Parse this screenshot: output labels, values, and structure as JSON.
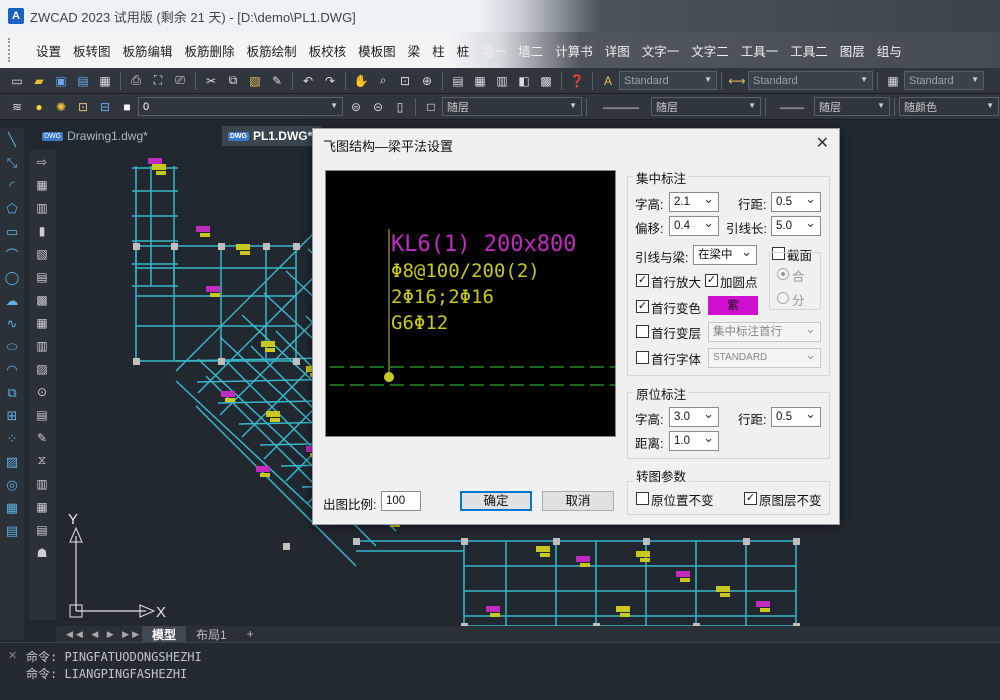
{
  "window": {
    "title": "ZWCAD 2023 试用版 (剩余 21 天) - [D:\\demo\\PL1.DWG]",
    "logo": "A"
  },
  "menu": [
    "设置",
    "板转图",
    "板筋编辑",
    "板筋删除",
    "板筋绘制",
    "板校核",
    "模板图",
    "梁",
    "柱",
    "桩",
    "墙一",
    "墙二",
    "计算书",
    "详图",
    "文字一",
    "文字二",
    "工具一",
    "工具二",
    "图层",
    "组与"
  ],
  "toolbar1": {
    "text_style": "Standard",
    "dim_style": "Standard",
    "table_style": "Standard"
  },
  "toolbar2": {
    "layer_name": "0",
    "color": "随层",
    "linetype": "随层",
    "lineweight": "随层",
    "plotstyle": "随颜色"
  },
  "doc_tabs": [
    {
      "label": "Drawing1.dwg*",
      "badge": "DWG"
    },
    {
      "label": "PL1.DWG*",
      "badge": "DWG"
    }
  ],
  "model_tabs": {
    "model": "模型",
    "layout": "布局1",
    "add": "+"
  },
  "ucs": {
    "x": "X",
    "y": "Y"
  },
  "command_lines": [
    "命令: PINGFATUODONGSHEZHI",
    "命令: LIANGPINGFASHEZHI"
  ],
  "dialog": {
    "title": "飞图结构—梁平法设置",
    "preview": {
      "line1": "KL6(1) 200x800",
      "line2": "Φ8@100/200(2)",
      "line3": "2Φ16;2Φ16",
      "line4": "G6Φ12",
      "color_title": "#c02cc0",
      "color_text": "#c8c81e",
      "color_beam": "#2fd22f"
    },
    "group_jizhong": {
      "title": "集中标注",
      "zigao_label": "字高:",
      "zigao": "2.1",
      "hangju_label": "行距:",
      "hangju": "0.5",
      "pianyi_label": "偏移:",
      "pianyi": "0.4",
      "yinxianchang_label": "引线长:",
      "yinxianchang": "5.0",
      "yinxianliang_label": "引线与梁:",
      "yinxianliang": "在梁中",
      "jiemian_label": "截面",
      "he_label": "合",
      "fen_label": "分",
      "shouhang_fangda": "首行放大",
      "jia_yuanquan": "加圆点",
      "shouhang_bianse": "首行变色",
      "color_name": "紫",
      "color_swatch": "#d10fd1",
      "shouhang_biance": "首行变层",
      "layer_value": "集中标注首行",
      "shouhang_ziti": "首行字体",
      "font_value": "STANDARD"
    },
    "group_yuanwei": {
      "title": "原位标注",
      "zigao_label": "字高:",
      "zigao": "3.0",
      "hangju_label": "行距:",
      "hangju": "0.5",
      "juli_label": "距离:",
      "juli": "1.0"
    },
    "group_zhuantu": {
      "title": "转图参数",
      "yuanweizhi": "原位置不变",
      "yuantuceng": "原图层不变"
    },
    "scale_label": "出图比例:",
    "scale_value": "100",
    "ok": "确定",
    "cancel": "取消"
  }
}
